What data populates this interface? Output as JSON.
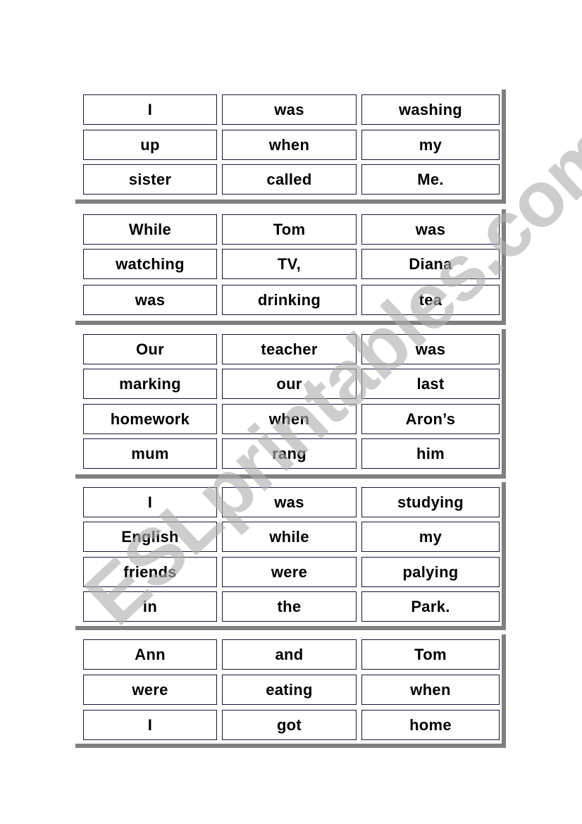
{
  "worksheet": {
    "blocks": [
      {
        "rows": [
          [
            "I",
            "was",
            "washing"
          ],
          [
            "up",
            "when",
            "my"
          ],
          [
            "sister",
            "called",
            "Me."
          ]
        ]
      },
      {
        "rows": [
          [
            "While",
            "Tom",
            "was"
          ],
          [
            "watching",
            "TV,",
            "Diana"
          ],
          [
            "was",
            "drinking",
            "tea"
          ]
        ]
      },
      {
        "rows": [
          [
            "Our",
            "teacher",
            "was"
          ],
          [
            "marking",
            "our",
            "last"
          ],
          [
            "homework",
            "when",
            "Aron’s"
          ],
          [
            "mum",
            "rang",
            "him"
          ]
        ]
      },
      {
        "rows": [
          [
            "I",
            "was",
            "studying"
          ],
          [
            "English",
            "while",
            "my"
          ],
          [
            "friends",
            "were",
            "palying"
          ],
          [
            "in",
            "the",
            "Park."
          ]
        ]
      },
      {
        "rows": [
          [
            "Ann",
            "and",
            "Tom"
          ],
          [
            "were",
            "eating",
            "when"
          ],
          [
            "I",
            "got",
            "home"
          ]
        ]
      }
    ]
  },
  "watermark": {
    "text": "ESLprintables.com"
  },
  "colors": {
    "frame": "#7f7f7f",
    "cell_border": "#14143a",
    "watermark": "#c8c8c8"
  }
}
